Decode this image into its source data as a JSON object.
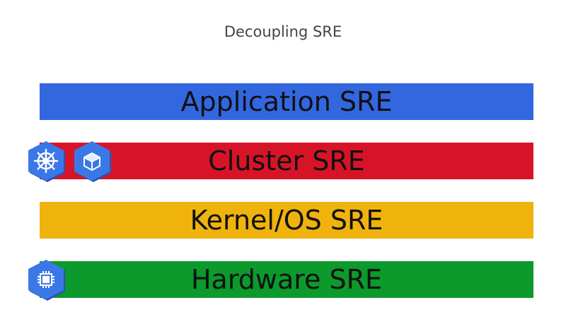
{
  "title": "Decoupling SRE",
  "layers": [
    {
      "label": "Application SRE",
      "color": "#3367e0"
    },
    {
      "label": "Cluster SRE",
      "color": "#d71427"
    },
    {
      "label": "Kernel/OS SRE",
      "color": "#f0b30e"
    },
    {
      "label": "Hardware SRE",
      "color": "#0b9a2b"
    }
  ],
  "icons": {
    "cluster": [
      "kubernetes-helm-icon",
      "container-cube-icon"
    ],
    "hardware": [
      "cpu-chip-icon"
    ],
    "hex_color": "#3b78e7",
    "hex_shadow": "#2a55b8"
  }
}
